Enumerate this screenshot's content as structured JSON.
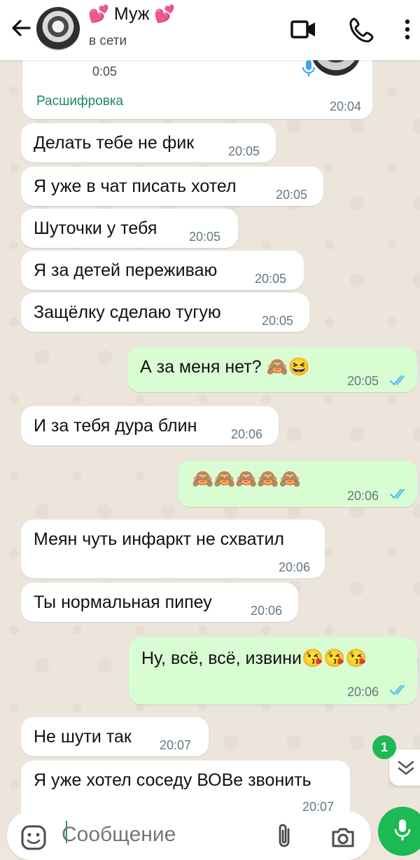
{
  "header": {
    "name": "Муж",
    "heart": "💕",
    "status": "в сети"
  },
  "voice": {
    "duration": "0:05",
    "transcribe": "Расшифровка",
    "time": "20:04"
  },
  "messages": [
    {
      "dir": "in",
      "text": "Делать тебе не фик",
      "time": "20:05"
    },
    {
      "dir": "in",
      "text": "Я уже в чат писать хотел",
      "time": "20:05"
    },
    {
      "dir": "in",
      "text": "Шуточки у тебя",
      "time": "20:05"
    },
    {
      "dir": "in",
      "text": "Я за детей переживаю",
      "time": "20:05"
    },
    {
      "dir": "in",
      "text": "Защёлку сделаю тугую",
      "time": "20:05"
    },
    {
      "dir": "out",
      "text": "А за меня нет? 🙈😆",
      "time": "20:05"
    },
    {
      "dir": "in",
      "text": "И за тебя дура блин",
      "time": "20:06"
    },
    {
      "dir": "out",
      "text": "🙈🙈🙈🙈🙈",
      "time": "20:06"
    },
    {
      "dir": "in",
      "text": "Меян чуть инфаркт не схватил",
      "time": "20:06"
    },
    {
      "dir": "in",
      "text": "Ты нормальная пипеу",
      "time": "20:06"
    },
    {
      "dir": "out",
      "text": "Ну, всё, всё, извини😘😘😘",
      "time": "20:06"
    },
    {
      "dir": "in",
      "text": "Не шути так",
      "time": "20:07"
    },
    {
      "dir": "in",
      "text": "Я уже хотел соседу ВОВе звонить",
      "time": "20:07"
    }
  ],
  "unread_count": "1",
  "composer": {
    "placeholder": "Сообщение"
  },
  "colors": {
    "accent": "#1db954",
    "outgoing": "#d9fdd3",
    "incoming": "#ffffff",
    "read_ticks": "#53bdeb"
  }
}
